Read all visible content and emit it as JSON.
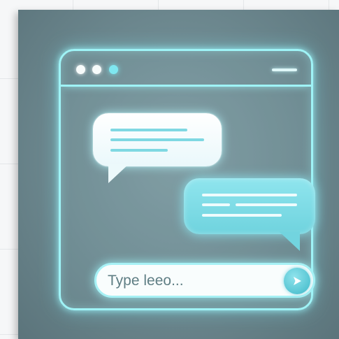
{
  "window": {
    "title_dots": [
      "close",
      "minimize",
      "maximize"
    ],
    "menu_icon": "hamburger-line-icon"
  },
  "messages": [
    {
      "side": "left",
      "style": "received",
      "lines": 3
    },
    {
      "side": "right",
      "style": "sent",
      "lines": 3
    }
  ],
  "composer": {
    "placeholder": "Type leeo...",
    "value": "",
    "send_icon": "send-icon"
  },
  "colors": {
    "panel": "#6c878e",
    "glow": "#9ff3f6",
    "accent": "#56c5d3",
    "bubble_received": "#ffffff",
    "bubble_sent": "#7fdce6"
  }
}
